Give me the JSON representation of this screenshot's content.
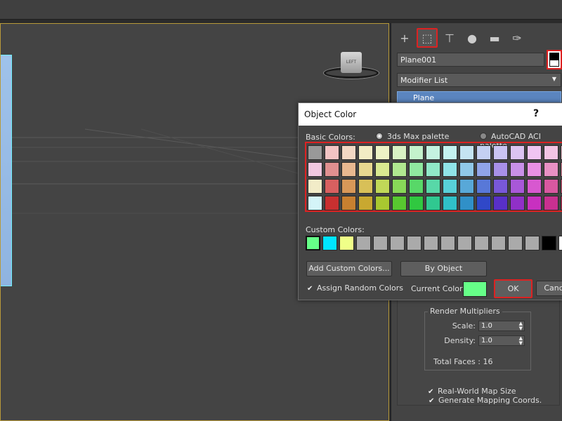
{
  "colors": {
    "accent_red": "#dd2222",
    "current_color": "#66ff88",
    "stack_highlight": "#5b85bf"
  },
  "command_panel": {
    "tabs": [
      {
        "icon": "plus-icon",
        "glyph": "+"
      },
      {
        "icon": "modify-curve-icon",
        "glyph": "⬚"
      },
      {
        "icon": "hierarchy-icon",
        "glyph": "⊤"
      },
      {
        "icon": "motion-icon",
        "glyph": "●"
      },
      {
        "icon": "display-monitor-icon",
        "glyph": "▬"
      },
      {
        "icon": "wrench-icon",
        "glyph": "✑"
      }
    ],
    "object_name": "Plane001",
    "modifier_list": "Modifier List",
    "stack_item": "Plane",
    "render_multipliers": {
      "title": "Render Multipliers",
      "scale_label": "Scale:",
      "scale_value": "1.0",
      "density_label": "Density:",
      "density_value": "1.0",
      "total_faces": "Total Faces : 16"
    },
    "generate_mapping": "Generate Mapping Coords.",
    "real_world": "Real-World Map Size"
  },
  "viewport": {
    "viewcube_label": "LEFT"
  },
  "dialog": {
    "title": "Object Color",
    "help": "?",
    "basic_colors_label": "Basic Colors:",
    "palette_3ds": "3ds Max palette",
    "palette_aci": "AutoCAD ACI palette",
    "basic_colors": [
      [
        "#999999",
        "#f2c4c4",
        "#f2d8c4",
        "#f2ecc4",
        "#ecf2c4",
        "#d8f2c4",
        "#c4f2cc",
        "#c4f2e0",
        "#c4f2f0",
        "#c4e4f2",
        "#c4d0f2",
        "#cac4f2",
        "#dcc4f2",
        "#f0c4f2",
        "#f2c4e4",
        "#f2c4d0"
      ],
      [
        "#f0c8e0",
        "#e09090",
        "#e8b890",
        "#e8d890",
        "#d8e890",
        "#b0e890",
        "#90e8a0",
        "#90e8c8",
        "#90e4e8",
        "#90c8e8",
        "#90a4e8",
        "#a890e8",
        "#c890e8",
        "#e890e4",
        "#e890c4",
        "#e890a4"
      ],
      [
        "#f2ecc8",
        "#d86060",
        "#d89858",
        "#d8c058",
        "#c0d858",
        "#88d858",
        "#58d868",
        "#58d8a8",
        "#58d0d8",
        "#58a8d8",
        "#5878d8",
        "#7858d8",
        "#a858d8",
        "#d858d0",
        "#d858a0",
        "#d85878"
      ],
      [
        "#d4f4f8",
        "#c83030",
        "#c88030",
        "#c8a830",
        "#a8c830",
        "#58c830",
        "#30c840",
        "#30c890",
        "#30c0c8",
        "#3090c8",
        "#3048c8",
        "#5830c8",
        "#9030c8",
        "#c830c0",
        "#c83090",
        "#c83058"
      ]
    ],
    "custom_colors_label": "Custom Colors:",
    "custom_colors": [
      "#66ff88",
      "#00e5ff",
      "#f0ff88",
      "#aaaaaa",
      "#aaaaaa",
      "#aaaaaa",
      "#aaaaaa",
      "#aaaaaa",
      "#aaaaaa",
      "#aaaaaa",
      "#aaaaaa",
      "#aaaaaa",
      "#aaaaaa",
      "#aaaaaa",
      "#000000",
      "#ffffff"
    ],
    "add_custom_colors": "Add Custom Colors...",
    "by_object": "By Object",
    "assign_random": "Assign Random Colors",
    "current_color_label": "Current Color:",
    "ok": "OK",
    "cancel": "Cancel"
  }
}
